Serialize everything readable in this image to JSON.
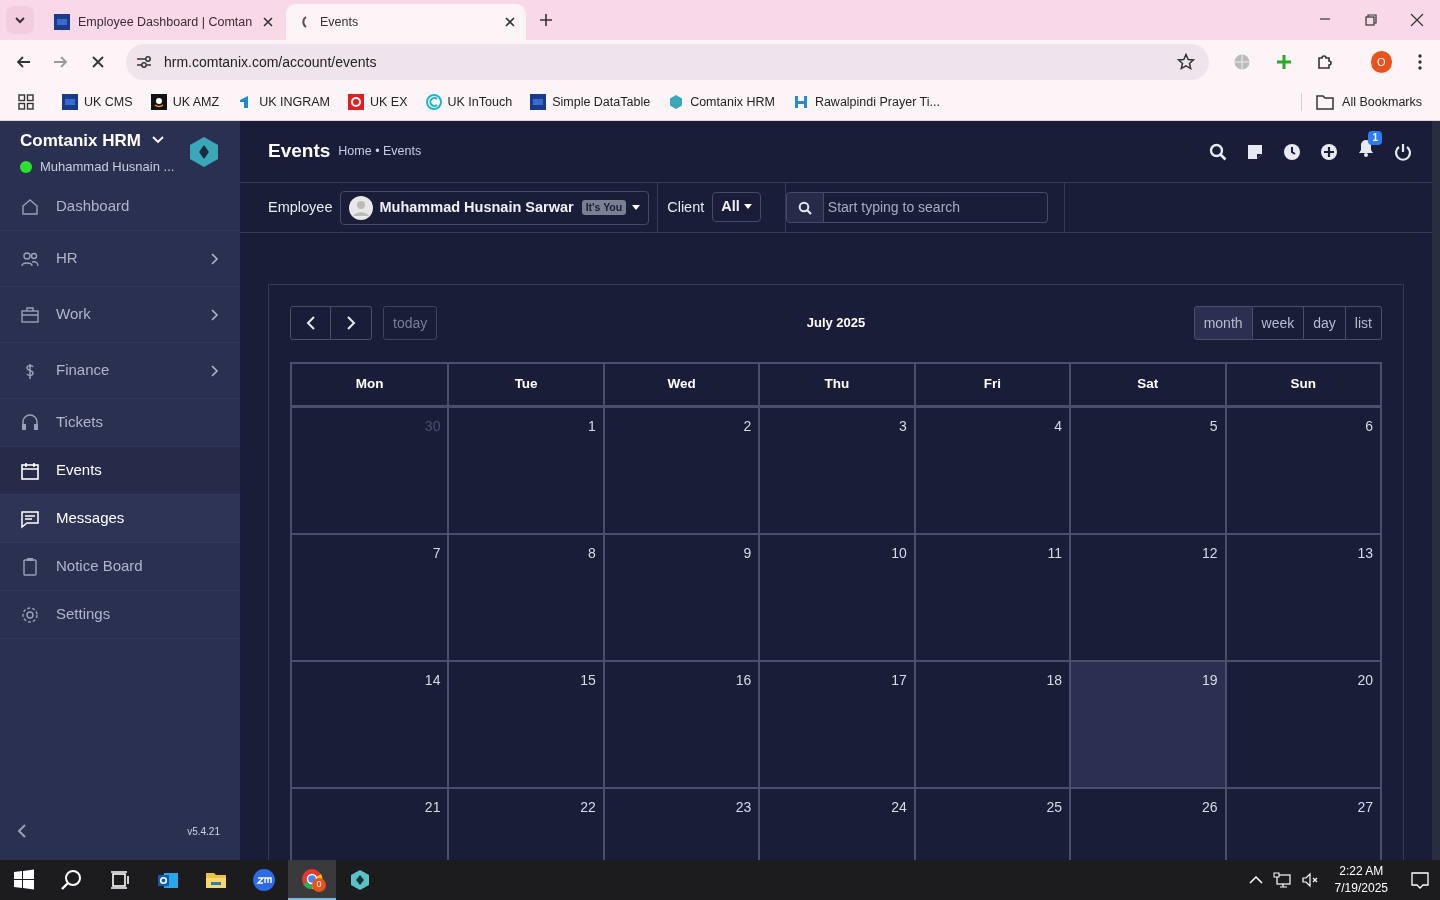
{
  "browser": {
    "tabs": [
      {
        "title": "Employee Dashboard | Comtan",
        "selected": false,
        "loading": false
      },
      {
        "title": "Events",
        "selected": true,
        "loading": true
      }
    ],
    "address": "hrm.comtanix.com/account/events",
    "bookmarks": [
      {
        "label": "UK CMS",
        "kind": "df"
      },
      {
        "label": "UK AMZ",
        "kind": "amz"
      },
      {
        "label": "UK INGRAM",
        "kind": "ingram"
      },
      {
        "label": "UK EX",
        "kind": "ex"
      },
      {
        "label": "UK InTouch",
        "kind": "intouch"
      },
      {
        "label": "Simple DataTable",
        "kind": "df"
      },
      {
        "label": "Comtanix HRM",
        "kind": "hex"
      },
      {
        "label": "Rawalpindi Prayer Ti...",
        "kind": "h"
      }
    ],
    "all_bookmarks": "All Bookmarks",
    "profile": "O"
  },
  "app": {
    "brand": "Comtanix HRM",
    "user": "Muhammad Husnain ...",
    "online": true,
    "sidebar": [
      {
        "label": "Dashboard",
        "expandable": false,
        "selected": false,
        "hovered": false
      },
      {
        "label": "HR",
        "expandable": true,
        "selected": false,
        "hovered": false
      },
      {
        "label": "Work",
        "expandable": true,
        "selected": false,
        "hovered": false
      },
      {
        "label": "Finance",
        "expandable": true,
        "selected": false,
        "hovered": false
      },
      {
        "label": "Tickets",
        "expandable": false,
        "selected": false,
        "hovered": false
      },
      {
        "label": "Events",
        "expandable": false,
        "selected": true,
        "hovered": false
      },
      {
        "label": "Messages",
        "expandable": false,
        "selected": false,
        "hovered": true
      },
      {
        "label": "Notice Board",
        "expandable": false,
        "selected": false,
        "hovered": false
      },
      {
        "label": "Settings",
        "expandable": false,
        "selected": false,
        "hovered": false
      }
    ],
    "version": "v5.4.21",
    "page_title": "Events",
    "breadcrumb": "Home • Events",
    "notification_count": "1",
    "filters": {
      "employee_label": "Employee",
      "employee": "Muhammad Husnain Sarwar",
      "employee_badge": "It's You",
      "client_label": "Client",
      "client": "All",
      "search_placeholder": "Start typing to search"
    },
    "calendar": {
      "today_button": "today",
      "title": "July 2025",
      "views": [
        {
          "label": "month",
          "selected": true
        },
        {
          "label": "week",
          "selected": false
        },
        {
          "label": "day",
          "selected": false
        },
        {
          "label": "list",
          "selected": false
        }
      ],
      "weekdays": [
        "Mon",
        "Tue",
        "Wed",
        "Thu",
        "Fri",
        "Sat",
        "Sun"
      ],
      "weeks": [
        [
          {
            "day": "30",
            "other_month": true,
            "today": false
          },
          {
            "day": "1",
            "other_month": false,
            "today": false
          },
          {
            "day": "2",
            "other_month": false,
            "today": false
          },
          {
            "day": "3",
            "other_month": false,
            "today": false
          },
          {
            "day": "4",
            "other_month": false,
            "today": false
          },
          {
            "day": "5",
            "other_month": false,
            "today": false
          },
          {
            "day": "6",
            "other_month": false,
            "today": false
          }
        ],
        [
          {
            "day": "7",
            "other_month": false,
            "today": false
          },
          {
            "day": "8",
            "other_month": false,
            "today": false
          },
          {
            "day": "9",
            "other_month": false,
            "today": false
          },
          {
            "day": "10",
            "other_month": false,
            "today": false
          },
          {
            "day": "11",
            "other_month": false,
            "today": false
          },
          {
            "day": "12",
            "other_month": false,
            "today": false
          },
          {
            "day": "13",
            "other_month": false,
            "today": false
          }
        ],
        [
          {
            "day": "14",
            "other_month": false,
            "today": false
          },
          {
            "day": "15",
            "other_month": false,
            "today": false
          },
          {
            "day": "16",
            "other_month": false,
            "today": false
          },
          {
            "day": "17",
            "other_month": false,
            "today": false
          },
          {
            "day": "18",
            "other_month": false,
            "today": false
          },
          {
            "day": "19",
            "other_month": false,
            "today": true
          },
          {
            "day": "20",
            "other_month": false,
            "today": false
          }
        ],
        [
          {
            "day": "21",
            "other_month": false,
            "today": false
          },
          {
            "day": "22",
            "other_month": false,
            "today": false
          },
          {
            "day": "23",
            "other_month": false,
            "today": false
          },
          {
            "day": "24",
            "other_month": false,
            "today": false
          },
          {
            "day": "25",
            "other_month": false,
            "today": false
          },
          {
            "day": "26",
            "other_month": false,
            "today": false
          },
          {
            "day": "27",
            "other_month": false,
            "today": false
          }
        ]
      ]
    }
  },
  "taskbar": {
    "chrome_badge": "0",
    "time": "2:22 AM",
    "date": "7/19/2025"
  }
}
